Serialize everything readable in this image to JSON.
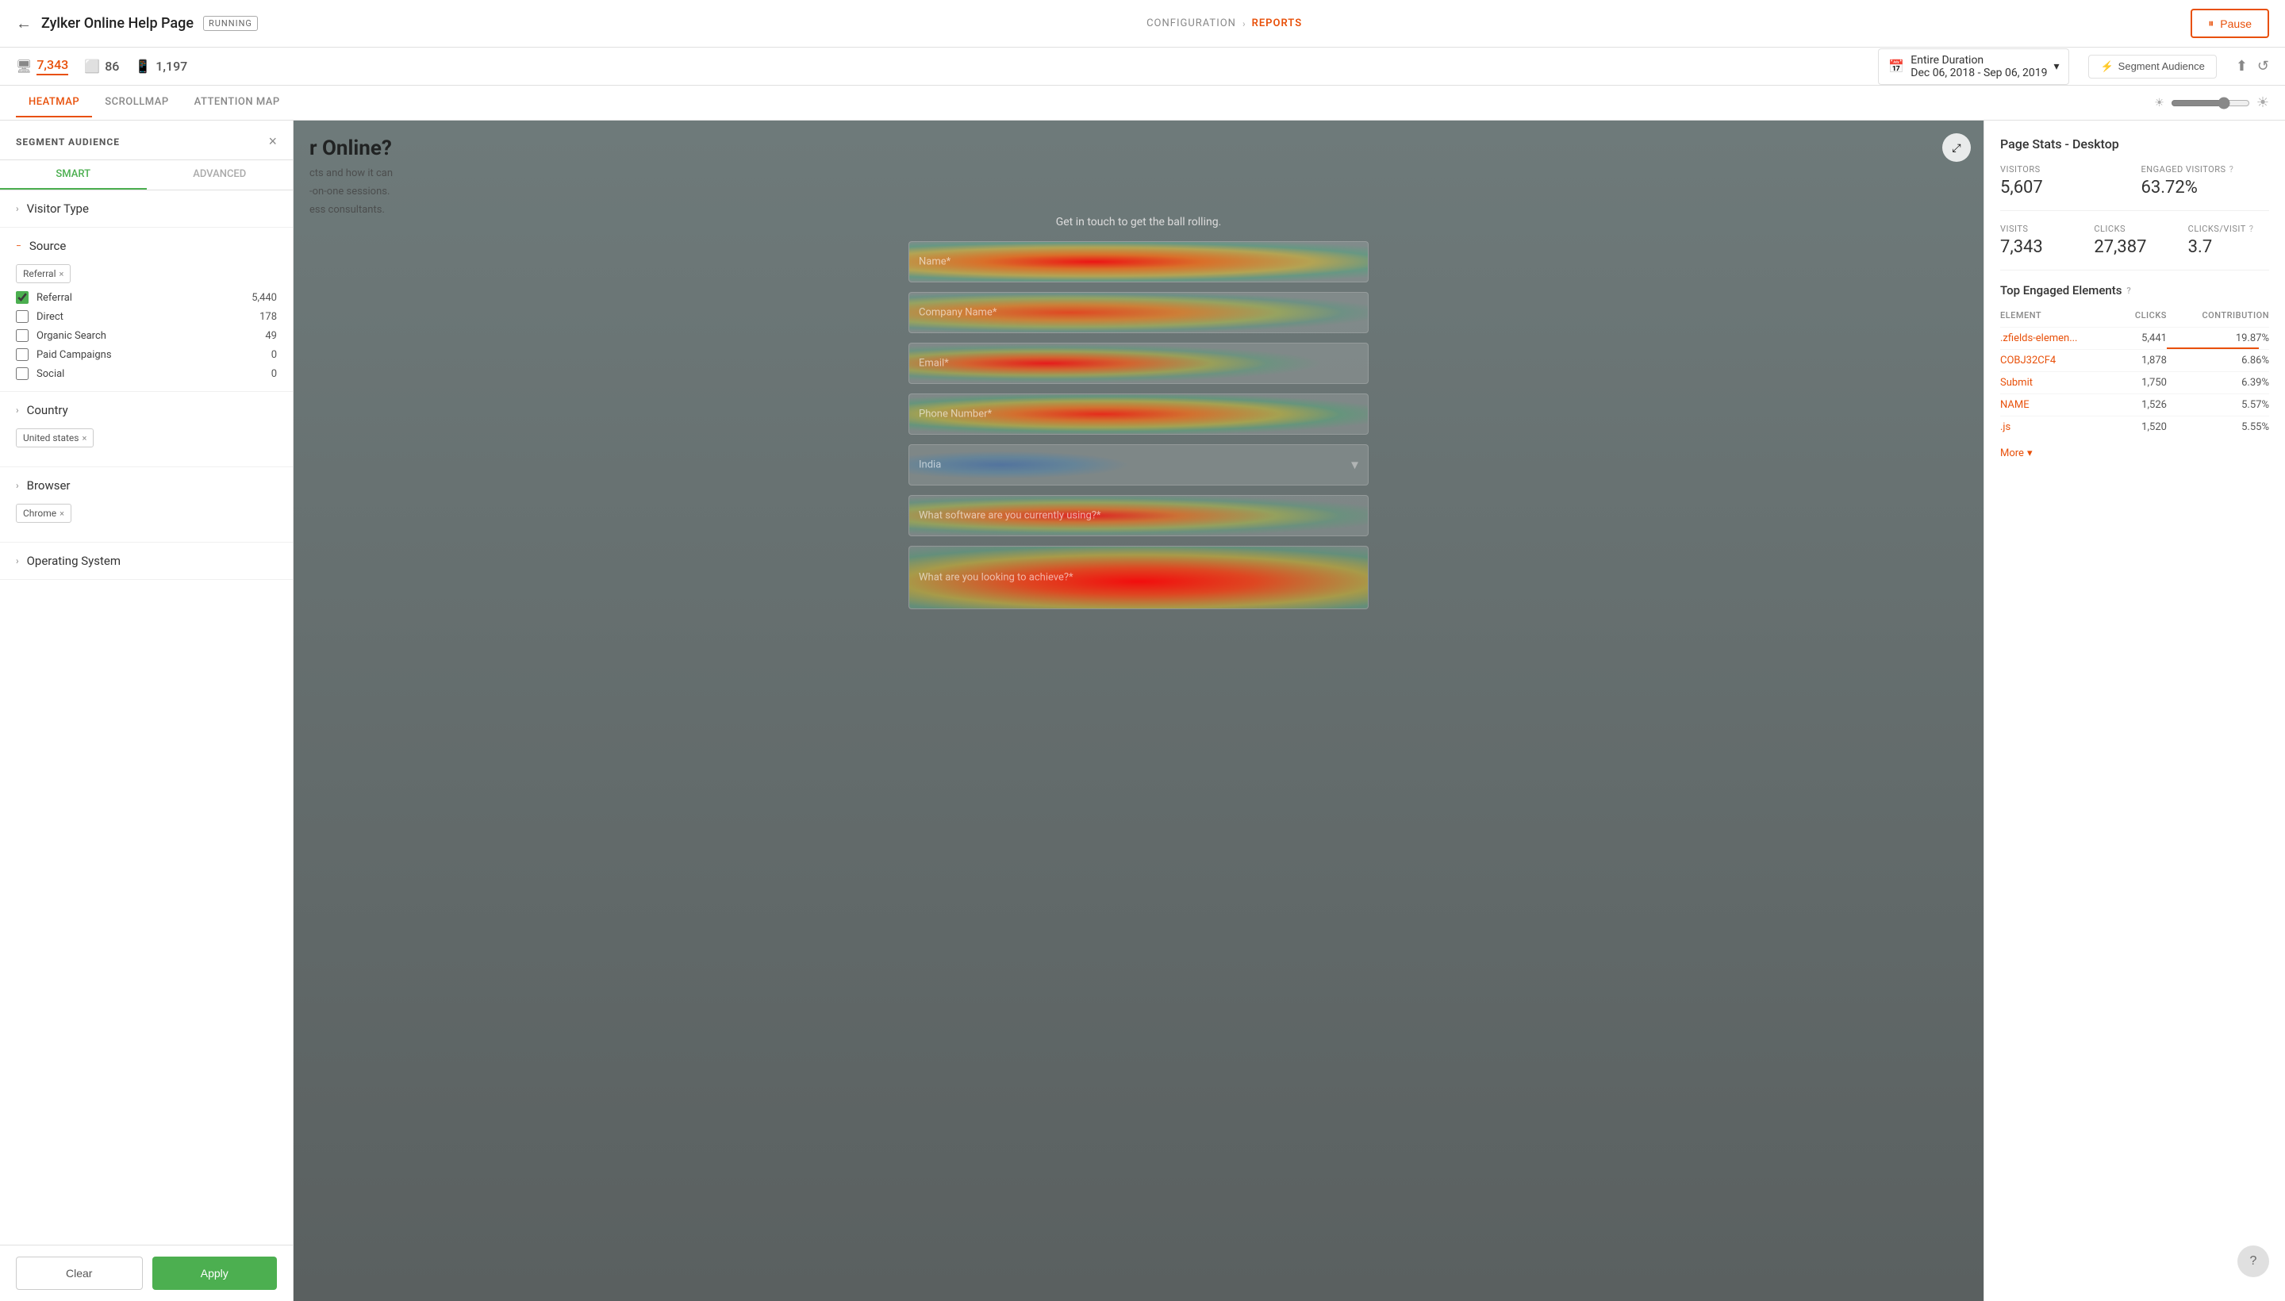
{
  "header": {
    "back_label": "←",
    "page_title": "Zylker Online Help Page",
    "status_badge": "RUNNING",
    "nav_config": "CONFIGURATION",
    "nav_arrow": "›",
    "nav_reports": "REPORTS",
    "pause_icon": "⏸",
    "pause_label": "Pause"
  },
  "sub_header": {
    "desktop_count": "7,343",
    "tablet_count": "86",
    "mobile_count": "1,197",
    "date_label": "Entire Duration",
    "date_range": "Dec 06, 2018 - Sep 06, 2019",
    "segment_label": "Segment Audience",
    "share_icon": "share",
    "refresh_icon": "refresh"
  },
  "tabs": {
    "heatmap": "HEATMAP",
    "scrollmap": "SCROLLMAP",
    "attention_map": "ATTENTION MAP"
  },
  "segment_panel": {
    "title": "SEGMENT AUDIENCE",
    "close_icon": "×",
    "smart_tab": "SMART",
    "advanced_tab": "ADVANCED",
    "visitor_type_label": "Visitor Type",
    "source_label": "Source",
    "source_tag": "Referral",
    "country_label": "Country",
    "country_tag": "United states",
    "browser_label": "Browser",
    "browser_tag": "Chrome",
    "os_label": "Operating System",
    "checkboxes": [
      {
        "label": "Referral",
        "count": "5,440",
        "checked": true
      },
      {
        "label": "Direct",
        "count": "178",
        "checked": false
      },
      {
        "label": "Organic Search",
        "count": "49",
        "checked": false
      },
      {
        "label": "Paid Campaigns",
        "count": "0",
        "checked": false
      },
      {
        "label": "Social",
        "count": "0",
        "checked": false
      }
    ],
    "clear_btn": "Clear",
    "apply_btn": "Apply"
  },
  "heatmap": {
    "headline": "r Online?",
    "sub_text": "cts and how it can",
    "sub_text2": "-on-one sessions.",
    "sub_text3": "ess consultants.",
    "form_cta": "Get in touch to get the ball rolling.",
    "fields": [
      {
        "placeholder": "Name*"
      },
      {
        "placeholder": "Company Name*"
      },
      {
        "placeholder": "Email*"
      },
      {
        "placeholder": "Phone Number*"
      },
      {
        "placeholder": "India"
      },
      {
        "placeholder": "What software are you currently using?*"
      },
      {
        "placeholder": "What are you looking to achieve?*"
      }
    ],
    "expand_icon": "⤢"
  },
  "stats": {
    "title": "Page Stats - Desktop",
    "visitors_label": "VISITORS",
    "visitors_value": "5,607",
    "engaged_label": "ENGAGED VISITORS",
    "engaged_value": "63.72%",
    "visits_label": "VISITS",
    "visits_value": "7,343",
    "clicks_label": "CLICKS",
    "clicks_value": "27,387",
    "clicks_per_visit_label": "CLICKS/VISIT",
    "clicks_per_visit_value": "3.7",
    "top_engaged_title": "Top Engaged Elements",
    "table_headers": {
      "element": "ELEMENT",
      "clicks": "CLICKS",
      "contribution": "CONTRIBUTION"
    },
    "elements": [
      {
        "name": ".zfields-elemen...",
        "clicks": "5,441",
        "contribution": "19.87%",
        "bar_width": "90"
      },
      {
        "name": "COBJ32CF4",
        "clicks": "1,878",
        "contribution": "6.86%",
        "bar_width": "31"
      },
      {
        "name": "Submit",
        "clicks": "1,750",
        "contribution": "6.39%",
        "bar_width": "29"
      },
      {
        "name": "NAME",
        "clicks": "1,526",
        "contribution": "5.57%",
        "bar_width": "25"
      },
      {
        "name": ".js",
        "clicks": "1,520",
        "contribution": "5.55%",
        "bar_width": "25"
      }
    ],
    "more_label": "More",
    "more_icon": "▾"
  }
}
